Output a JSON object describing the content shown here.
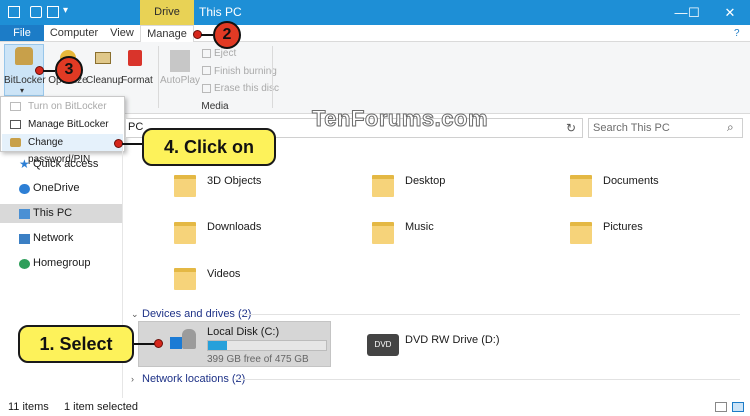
{
  "window": {
    "title": "This PC",
    "context_tab": "Drive Tools",
    "controls": {
      "minimize": "—",
      "maximize": "☐",
      "close": "✕"
    }
  },
  "ribbon_tabs": [
    "File",
    "Computer",
    "View",
    "Manage"
  ],
  "ribbon": {
    "bitlocker_label": "BitLocker",
    "optimize_label": "Optimize",
    "cleanup_label": "Cleanup",
    "format_label": "Format",
    "autoplay_label": "AutoPlay",
    "eject_label": "Eject",
    "finish_burning_label": "Finish burning",
    "erase_disc_label": "Erase this disc",
    "media_group_label": "Media"
  },
  "bitlocker_menu": [
    {
      "label": "Turn on BitLocker",
      "disabled": true
    },
    {
      "label": "Manage BitLocker",
      "disabled": false
    },
    {
      "label": "Change password/PIN",
      "disabled": false
    }
  ],
  "address": {
    "path": "PC",
    "search_placeholder": "Search This PC"
  },
  "nav": [
    "Quick access",
    "OneDrive",
    "This PC",
    "Network",
    "Homegroup"
  ],
  "folders": [
    "3D Objects",
    "Desktop",
    "Documents",
    "Downloads",
    "Music",
    "Pictures",
    "Videos"
  ],
  "devices_header": "Devices and drives (2)",
  "drives": [
    {
      "name": "Local Disk (C:)",
      "free_text": "399 GB free of 475 GB",
      "used_fraction": 0.16
    },
    {
      "name": "DVD RW Drive (D:)"
    }
  ],
  "network_header": "Network locations (2)",
  "status": {
    "items": "11 items",
    "selected": "1 item selected"
  },
  "callouts": {
    "step1": "1. Select",
    "step4": "4. Click on",
    "step2": "2",
    "step3": "3"
  },
  "watermark": "TenForums.com"
}
